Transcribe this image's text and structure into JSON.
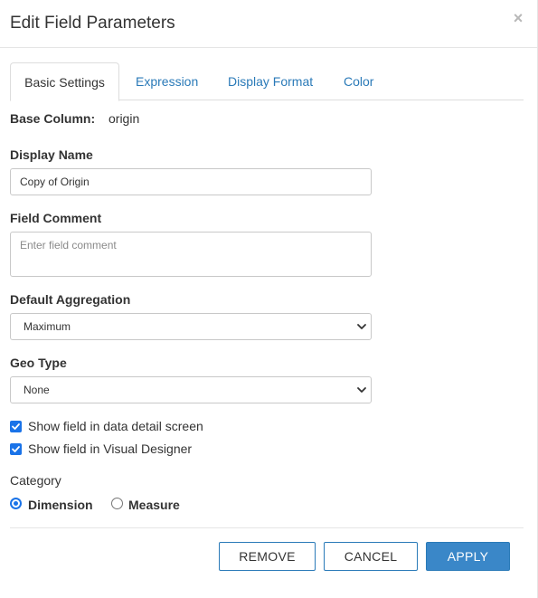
{
  "dialog": {
    "title": "Edit Field Parameters",
    "close_icon": "×"
  },
  "tabs": [
    {
      "label": "Basic Settings",
      "active": true
    },
    {
      "label": "Expression",
      "active": false
    },
    {
      "label": "Display Format",
      "active": false
    },
    {
      "label": "Color",
      "active": false
    }
  ],
  "base_column": {
    "label": "Base Column:",
    "value": "origin"
  },
  "display_name": {
    "label": "Display Name",
    "value": "Copy of Origin"
  },
  "field_comment": {
    "label": "Field Comment",
    "placeholder": "Enter field comment"
  },
  "default_aggregation": {
    "label": "Default Aggregation",
    "selected": "Maximum"
  },
  "geo_type": {
    "label": "Geo Type",
    "selected": "None"
  },
  "checkboxes": [
    {
      "label": "Show field in data detail screen",
      "checked": true
    },
    {
      "label": "Show field in Visual Designer",
      "checked": true
    }
  ],
  "category": {
    "label": "Category",
    "options": [
      {
        "label": "Dimension",
        "selected": true
      },
      {
        "label": "Measure",
        "selected": false
      }
    ]
  },
  "buttons": {
    "remove": "REMOVE",
    "cancel": "CANCEL",
    "apply": "APPLY"
  },
  "colors": {
    "accent": "#1a73e8",
    "link": "#2a7ab8",
    "primary_button": "#3a87c8"
  }
}
